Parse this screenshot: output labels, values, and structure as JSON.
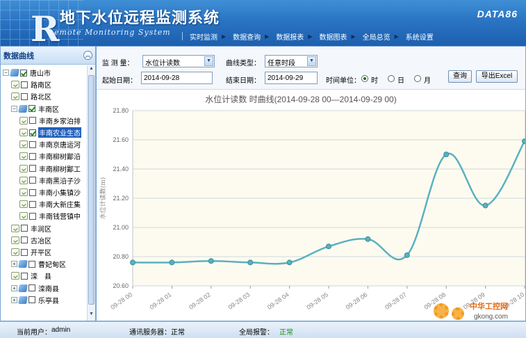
{
  "header": {
    "title": "地下水位远程监测系统",
    "subtitle": "emote Monitoring System",
    "logo_letter": "R",
    "brand": "DATA86",
    "nav": [
      "实时监测",
      "数据查询",
      "数据报表",
      "数据图表",
      "全局总览",
      "系统设置"
    ]
  },
  "sidebar": {
    "title": "数据曲线",
    "collapse_icon": "double-chevron-up-icon",
    "tree": [
      {
        "label": "唐山市",
        "level": 0,
        "type": "group",
        "toggle": "−",
        "checked": true
      },
      {
        "label": "路南区",
        "level": 1,
        "type": "leaf",
        "checked": false
      },
      {
        "label": "路北区",
        "level": 1,
        "type": "leaf",
        "checked": false
      },
      {
        "label": "丰南区",
        "level": 1,
        "type": "group",
        "toggle": "−",
        "checked": true
      },
      {
        "label": "丰南乡家泊排",
        "level": 2,
        "type": "leaf",
        "checked": false
      },
      {
        "label": "丰南农业生态",
        "level": 2,
        "type": "leaf",
        "checked": true,
        "selected": true
      },
      {
        "label": "丰南京唐运河",
        "level": 2,
        "type": "leaf",
        "checked": false
      },
      {
        "label": "丰南柳树鄙沿",
        "level": 2,
        "type": "leaf",
        "checked": false
      },
      {
        "label": "丰南柳树鄙工",
        "level": 2,
        "type": "leaf",
        "checked": false
      },
      {
        "label": "丰南黑沿子沙",
        "level": 2,
        "type": "leaf",
        "checked": false
      },
      {
        "label": "丰南小集镇沙",
        "level": 2,
        "type": "leaf",
        "checked": false
      },
      {
        "label": "丰南大新庄集",
        "level": 2,
        "type": "leaf",
        "checked": false
      },
      {
        "label": "丰南钱营镇中",
        "level": 2,
        "type": "leaf",
        "checked": false
      },
      {
        "label": "丰润区",
        "level": 1,
        "type": "leaf",
        "checked": false
      },
      {
        "label": "古冶区",
        "level": 1,
        "type": "leaf",
        "checked": false
      },
      {
        "label": "开平区",
        "level": 1,
        "type": "leaf",
        "checked": false
      },
      {
        "label": "曹妃甸区",
        "level": 1,
        "type": "group",
        "toggle": "+",
        "checked": false
      },
      {
        "label": "滦　县",
        "level": 1,
        "type": "leaf",
        "checked": false
      },
      {
        "label": "滦南县",
        "level": 1,
        "type": "group",
        "toggle": "+",
        "checked": false
      },
      {
        "label": "乐亭县",
        "level": 1,
        "type": "group",
        "toggle": "+",
        "checked": false
      }
    ]
  },
  "form": {
    "measure_label": "监 测 量：",
    "measure_value": "水位计读数",
    "curve_type_label": "曲线类型：",
    "curve_type_value": "任意时段",
    "start_label": "起始日期：",
    "start_value": "2014-09-28",
    "end_label": "结束日期：",
    "end_value": "2014-09-29",
    "unit_label": "时间单位：",
    "units": [
      {
        "label": "时",
        "selected": true
      },
      {
        "label": "日",
        "selected": false
      },
      {
        "label": "月",
        "selected": false
      }
    ],
    "query_button": "查询",
    "export_button": "导出Excel"
  },
  "chart_data": {
    "type": "line",
    "title": "水位计读数  时曲线(2014-09-28 00—2014-09-29 00)",
    "ylabel": "水位计读数(m)",
    "xlabel": "",
    "ylim": [
      20.6,
      21.8
    ],
    "yticks": [
      "20.60",
      "20.80",
      "21.00",
      "21.20",
      "21.40",
      "21.60",
      "21.80"
    ],
    "categories": [
      "09-28 00",
      "09-28 01",
      "09-28 02",
      "09-28 03",
      "09-28 04",
      "09-28 05",
      "09-28 06",
      "09-28 07",
      "09-28 08",
      "09-28 09",
      "09-28 10"
    ],
    "series": [
      {
        "values": [
          20.76,
          20.76,
          20.77,
          20.76,
          20.76,
          20.87,
          20.92,
          20.81,
          21.5,
          21.15,
          21.59
        ]
      }
    ],
    "colors": {
      "line": "#5ab0c0",
      "plot_bg": "#fdfbef",
      "grid": "#cfd8de"
    },
    "grid": true
  },
  "status": {
    "user_label": "当前用户：",
    "user": "admin",
    "comm_label": "通讯服务器：",
    "comm_value": "正常",
    "alarm_label": "全局报警：",
    "alarm_value": "正常"
  },
  "watermark": {
    "text1": "中华工控网",
    "text2": "gkong.com"
  }
}
